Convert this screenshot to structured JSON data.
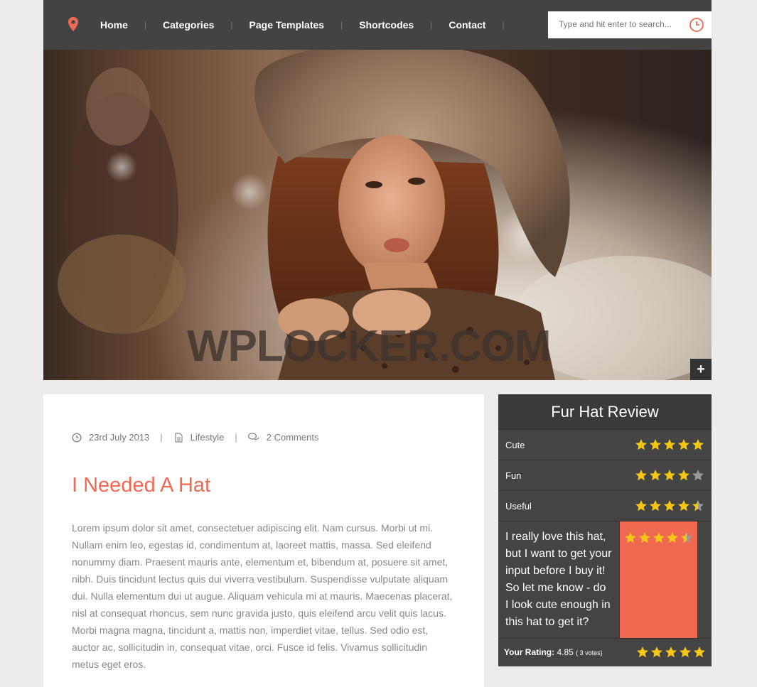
{
  "nav": {
    "items": [
      "Home",
      "Categories",
      "Page Templates",
      "Shortcodes",
      "Contact"
    ],
    "separator": "|"
  },
  "search": {
    "placeholder": "Type and hit enter to search..."
  },
  "hero": {
    "watermark": "WPLOCKER.COM",
    "expand_label": "+"
  },
  "post": {
    "date": "23rd July 2013",
    "category": "Lifestyle",
    "comments": "2 Comments",
    "title": "I Needed A Hat",
    "body": "Lorem ipsum dolor sit amet, consectetuer adipiscing elit. Nam cursus. Morbi ut mi. Nullam enim leo, egestas id, condimentum at, laoreet mattis, massa. Sed eleifend nonummy diam. Praesent mauris ante, elementum et, bibendum at, posuere sit amet, nibh. Duis tincidunt lectus quis dui viverra vestibulum. Suspendisse vulputate aliquam dui. Nulla elementum dui ut augue. Aliquam vehicula mi at mauris. Maecenas placerat, nisl at consequat rhoncus, sem nunc gravida justo, quis eleifend arcu velit quis lacus. Morbi magna magna, tincidunt a, mattis non, imperdiet vitae, tellus. Sed odio est, auctor ac, sollicitudin in, consequat vitae, orci. Fusce id felis. Vivamus sollicitudin metus eget eros."
  },
  "review": {
    "title": "Fur Hat Review",
    "criteria": [
      {
        "label": "Cute",
        "rating": 5
      },
      {
        "label": "Fun",
        "rating": 4
      },
      {
        "label": "Useful",
        "rating": 4.5
      }
    ],
    "summary": "I really love this hat, but I want to get your input before I buy it! So let me know - do I look cute enough in this hat to get it?",
    "summary_rating": 4.5,
    "user_rating_label": "Your Rating:",
    "user_rating_value": "4.85",
    "user_rating_votes": "( 3 votes)",
    "user_rating_stars": 5
  },
  "colors": {
    "accent": "#ef6950",
    "header": "#434343",
    "star": "#f5c518"
  }
}
